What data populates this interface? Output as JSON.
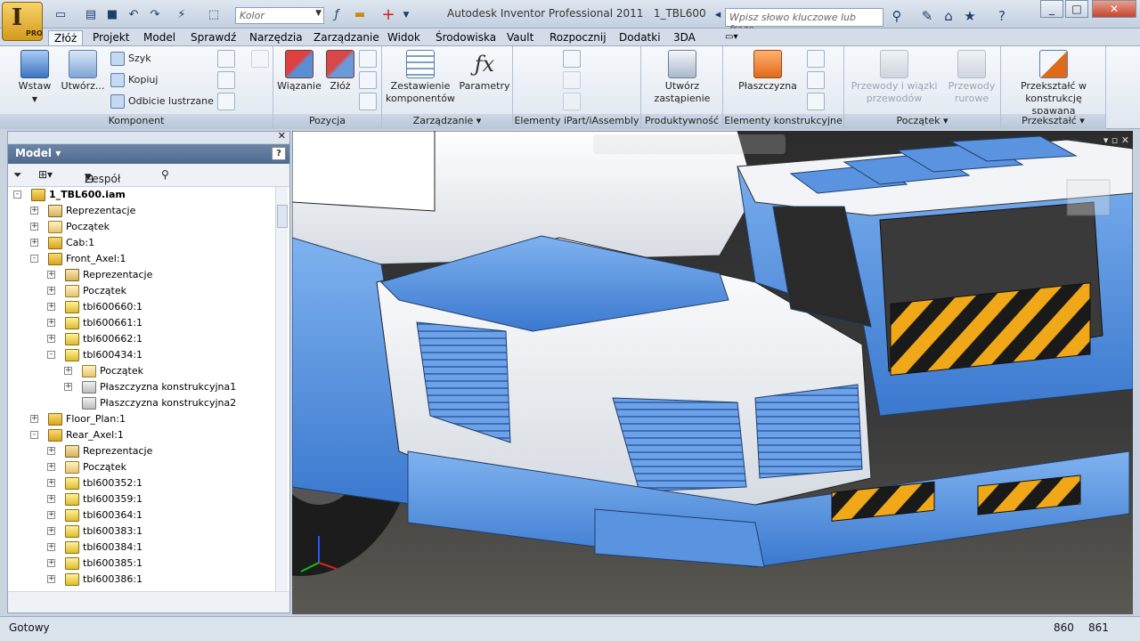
{
  "app": {
    "logo_label": "PRO",
    "title": "Autodesk Inventor Professional 2011",
    "document": "1_TBL600",
    "color_field": "Kolor",
    "search_placeholder": "Wpisz słowo kluczowe lub frazę"
  },
  "tabs": [
    "Złóż",
    "Projekt",
    "Model",
    "Sprawdź",
    "Narzędzia",
    "Zarządzanie",
    "Widok",
    "Środowiska",
    "Vault",
    "Rozpocznij",
    "Dodatki",
    "3DA"
  ],
  "active_tab": "Złóż",
  "ribbon": {
    "komponent": {
      "title": "Komponent",
      "wstaw": "Wstaw",
      "utworz": "Utwórz...",
      "szyk": "Szyk",
      "kopiuj": "Kopiuj",
      "odbicie": "Odbicie lustrzane"
    },
    "pozycja": {
      "title": "Pozycja",
      "wiazanie": "Wiązanie",
      "zloz": "Złóż"
    },
    "zarzadzanie": {
      "title": "Zarządzanie",
      "zestawienie": "Zestawienie komponentów",
      "parametry": "Parametry"
    },
    "ipart": {
      "title": "Elementy iPart/iAssembly"
    },
    "produktywnosc": {
      "title": "Produktywność",
      "utworz_zastapienie": "Utwórz zastąpienie"
    },
    "konstrukcyjne": {
      "title": "Elementy konstrukcyjne",
      "plaszczyzna": "Płaszczyzna"
    },
    "poczatek": {
      "title": "Początek",
      "przewody": "Przewody i wiązki przewodów",
      "rurowe": "Przewody rurowe"
    },
    "przeksztalc": {
      "title": "Przekształć",
      "spawana": "Przekształć w konstrukcję spawaną"
    }
  },
  "browser": {
    "title": "Model",
    "help": "?",
    "filter_label": "Zespół",
    "tree": [
      {
        "label": "1_TBL600.iam",
        "level": 0,
        "icon": "assembly-icon",
        "exp": "-"
      },
      {
        "label": "Reprezentacje",
        "level": 1,
        "icon": "representations-icon",
        "exp": "+"
      },
      {
        "label": "Początek",
        "level": 1,
        "icon": "origin-folder-icon",
        "exp": "+"
      },
      {
        "label": "Cab:1",
        "level": 1,
        "icon": "assembly-icon",
        "exp": "+"
      },
      {
        "label": "Front_Axel:1",
        "level": 1,
        "icon": "assembly-icon",
        "exp": "-"
      },
      {
        "label": "Reprezentacje",
        "level": 2,
        "icon": "representations-icon",
        "exp": "+"
      },
      {
        "label": "Początek",
        "level": 2,
        "icon": "origin-folder-icon",
        "exp": "+"
      },
      {
        "label": "tbl600660:1",
        "level": 2,
        "icon": "part-icon",
        "exp": "+"
      },
      {
        "label": "tbl600661:1",
        "level": 2,
        "icon": "part-icon",
        "exp": "+"
      },
      {
        "label": "tbl600662:1",
        "level": 2,
        "icon": "part-icon",
        "exp": "+"
      },
      {
        "label": "tbl600434:1",
        "level": 2,
        "icon": "part-icon",
        "exp": "-"
      },
      {
        "label": "Początek",
        "level": 3,
        "icon": "origin-folder-icon",
        "exp": "+"
      },
      {
        "label": "Płaszczyzna konstrukcyjna1",
        "level": 3,
        "icon": "work-plane-icon",
        "exp": "+"
      },
      {
        "label": "Płaszczyzna konstrukcyjna2",
        "level": 3,
        "icon": "work-plane-icon",
        "exp": ""
      },
      {
        "label": "Floor_Plan:1",
        "level": 1,
        "icon": "assembly-icon",
        "exp": "+"
      },
      {
        "label": "Rear_Axel:1",
        "level": 1,
        "icon": "assembly-icon",
        "exp": "-"
      },
      {
        "label": "Reprezentacje",
        "level": 2,
        "icon": "representations-icon",
        "exp": "+"
      },
      {
        "label": "Początek",
        "level": 2,
        "icon": "origin-folder-icon",
        "exp": "+"
      },
      {
        "label": "tbl600352:1",
        "level": 2,
        "icon": "part-icon",
        "exp": "+"
      },
      {
        "label": "tbl600359:1",
        "level": 2,
        "icon": "part-icon",
        "exp": "+"
      },
      {
        "label": "tbl600364:1",
        "level": 2,
        "icon": "part-icon",
        "exp": "+"
      },
      {
        "label": "tbl600383:1",
        "level": 2,
        "icon": "part-icon",
        "exp": "+"
      },
      {
        "label": "tbl600384:1",
        "level": 2,
        "icon": "part-icon",
        "exp": "+"
      },
      {
        "label": "tbl600385:1",
        "level": 2,
        "icon": "part-icon",
        "exp": "+"
      },
      {
        "label": "tbl600386:1",
        "level": 2,
        "icon": "part-icon",
        "exp": "+"
      }
    ]
  },
  "status": {
    "text": "Gotowy",
    "x": "860",
    "y": "861"
  },
  "colors": {
    "accent": "#4a86d4",
    "ribbon_bg": "#e8edf4",
    "title_bg": "#cfdae7"
  }
}
